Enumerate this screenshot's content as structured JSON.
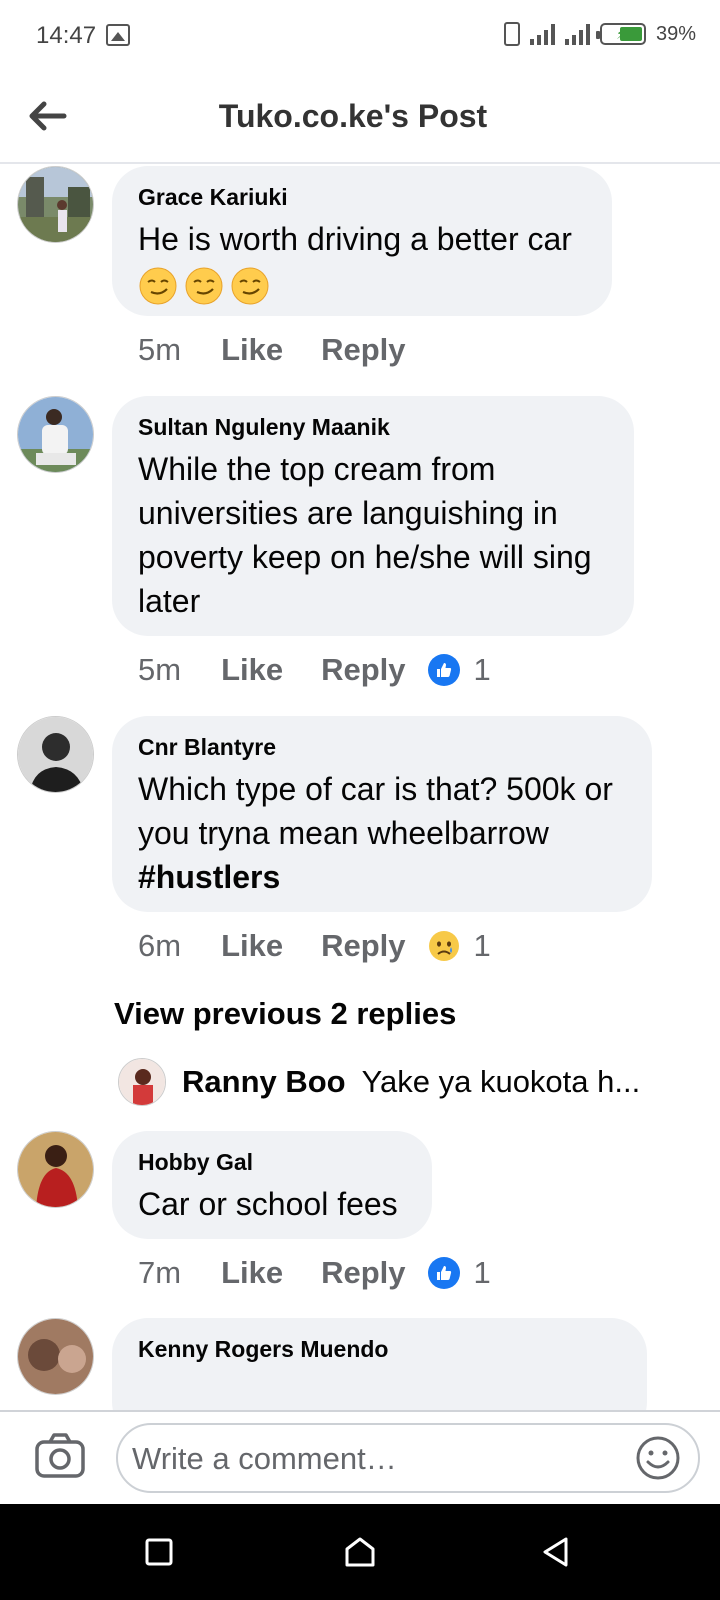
{
  "status_bar": {
    "time": "14:47",
    "battery": "39%"
  },
  "header": {
    "title": "Tuko.co.ke's Post"
  },
  "comments": [
    {
      "author": "Grace Kariuki",
      "text": "He is worth driving a better car",
      "emojis": [
        "smirking-face",
        "smirking-face",
        "smirking-face"
      ],
      "time": "5m",
      "like_label": "Like",
      "reply_label": "Reply"
    },
    {
      "author": "Sultan Nguleny Maanik",
      "text": "While the top cream from universities are languishing in poverty keep on he/she will sing later",
      "time": "5m",
      "like_label": "Like",
      "reply_label": "Reply",
      "reaction": "like",
      "reaction_count": "1"
    },
    {
      "author": "Cnr Blantyre",
      "text": "Which type of car is that? 500k or you tryna mean wheelbarrow",
      "hashtag": "#hustlers",
      "time": "6m",
      "like_label": "Like",
      "reply_label": "Reply",
      "reaction": "sad",
      "reaction_count": "1"
    },
    {
      "author": "Hobby Gal",
      "text": "Car or school fees",
      "time": "7m",
      "like_label": "Like",
      "reply_label": "Reply",
      "reaction": "like",
      "reaction_count": "1"
    },
    {
      "author": "Kenny Rogers Muendo"
    }
  ],
  "replies": {
    "view_previous": "View previous 2 replies",
    "latest_author": "Ranny Boo",
    "latest_text": "Yake ya kuokota h..."
  },
  "composer": {
    "placeholder": "Write a comment…"
  },
  "colors": {
    "bubble": "#f0f2f5",
    "meta": "#65676b",
    "like_blue": "#1877f2"
  }
}
